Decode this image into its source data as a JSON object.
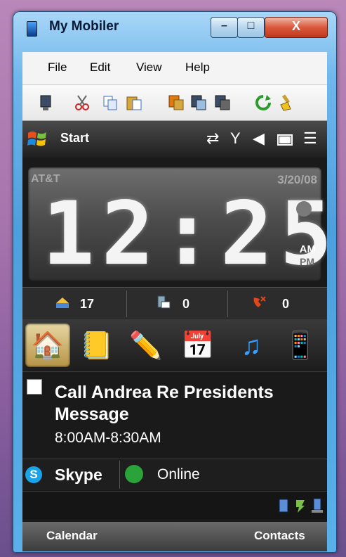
{
  "window": {
    "title": "My Mobiler",
    "minimize_glyph": "–",
    "maximize_glyph": "□",
    "close_glyph": "X"
  },
  "menu": {
    "items": [
      "File",
      "Edit",
      "View",
      "Help"
    ]
  },
  "toolbar": {
    "icons": [
      "device-icon",
      "cut-icon",
      "copy-icon",
      "paste-icon",
      "paste-special-icon",
      "screenshot-icon",
      "screenshot-alt-icon",
      "refresh-icon",
      "brush-icon"
    ]
  },
  "taskbar": {
    "start_label": "Start"
  },
  "home": {
    "carrier": "AT&T",
    "date": "3/20/08",
    "time": "12:25",
    "am": "AM",
    "pm": "PM",
    "counters": {
      "email": "17",
      "sms": "0",
      "missed_calls": "0"
    }
  },
  "appointment": {
    "title": "Call Andrea Re Presidents Message",
    "time": "8:00AM-8:30AM"
  },
  "skype": {
    "label": "Skype",
    "status": "Online"
  },
  "softkeys": {
    "left": "Calendar",
    "right": "Contacts"
  },
  "colors": {
    "skype_blue": "#1aa3e8",
    "online_green": "#2aa33a",
    "close_red": "#c0391f"
  }
}
